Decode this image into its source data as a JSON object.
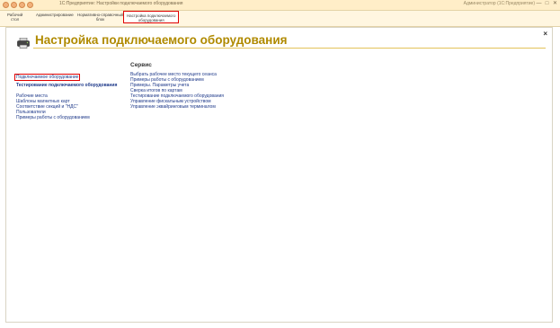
{
  "window": {
    "title": "1С:Предприятие: Настройки подключаемого оборудования",
    "right_text": "Администратор (1С:Предприятие)",
    "controls": [
      "—",
      "□",
      "✕"
    ]
  },
  "nav": {
    "items": [
      {
        "label_line1": "Рабочий",
        "label_line2": "стол"
      },
      {
        "label_line1": "Администрирование",
        "label_line2": ""
      },
      {
        "label_line1": "Нормативно-справочный",
        "label_line2": "блок"
      },
      {
        "label_line1": "Настройка подключаемого",
        "label_line2": "оборудования"
      }
    ]
  },
  "page": {
    "close_label": "×",
    "title": "Настройка подключаемого оборудования"
  },
  "left_links": {
    "group1": [
      "Подключаемое оборудование",
      "Тестирование подключаемого оборудования"
    ],
    "group2": [
      "Рабочие места",
      "Шаблоны магнитных карт",
      "Соответствие секций и \"НДС\"",
      "Пользователи",
      "Примеры работы с оборудованием"
    ]
  },
  "service": {
    "title": "Сервис",
    "links": [
      "Выбрать рабочее место текущего сеанса",
      "Примеры работы с оборудованием",
      "Примеры. Параметры учета",
      "Сверка итогов по картам",
      "Тестирование подключаемого оборудования",
      "Управление фискальным устройством",
      "Управление эквайринговым терминалом"
    ]
  },
  "colors": {
    "title_gold": "#b08a00",
    "link_blue": "#1f3a8a",
    "highlight_red": "#e00000",
    "titlebar_bg": "#ffeec8"
  }
}
